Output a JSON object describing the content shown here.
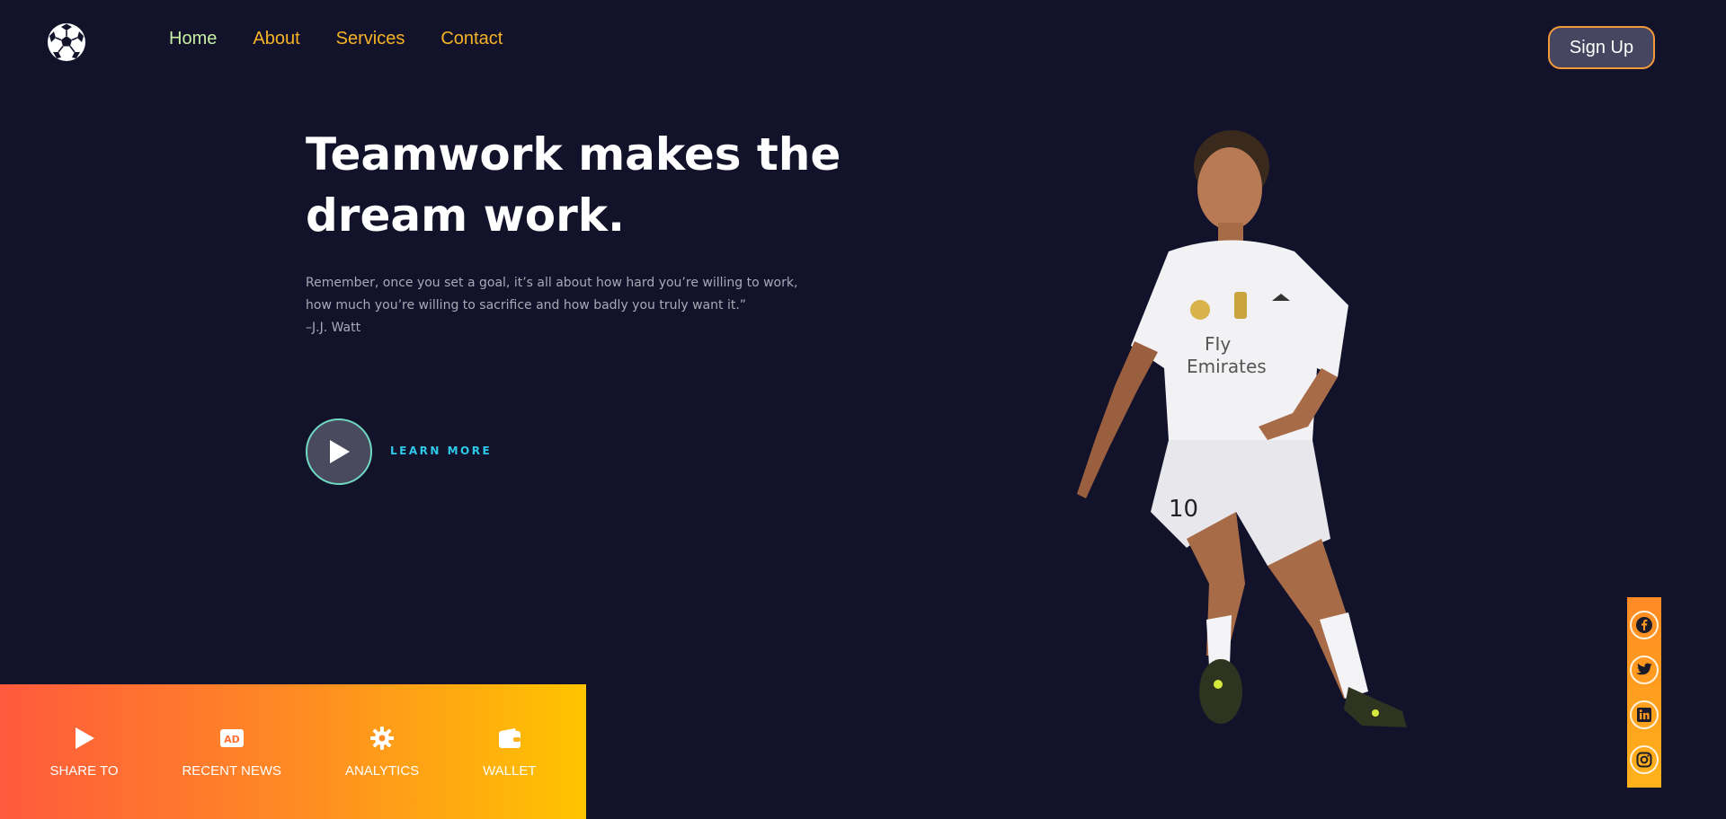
{
  "nav": {
    "items": [
      {
        "label": "Home",
        "active": true
      },
      {
        "label": "About",
        "active": false
      },
      {
        "label": "Services",
        "active": false
      },
      {
        "label": "Contact",
        "active": false
      }
    ],
    "signup_label": "Sign Up"
  },
  "hero": {
    "title": "Teamwork makes the dream work.",
    "quote_line1": "Remember, once you set a goal, it’s all about how hard you’re willing to work,",
    "quote_line2": "how much you’re willing to sacrifice and how badly you truly want it.”",
    "quote_author": "–J.J. Watt",
    "learn_more": "LEARN MORE"
  },
  "bottom_bar": {
    "items": [
      {
        "label": "SHARE TO",
        "icon": "play-icon"
      },
      {
        "label": "RECENT NEWS",
        "icon": "ad-icon",
        "badge": "AD"
      },
      {
        "label": "ANALYTICS",
        "icon": "gear-icon"
      },
      {
        "label": "WALLET",
        "icon": "wallet-icon"
      }
    ]
  },
  "social": [
    "facebook-icon",
    "twitter-icon",
    "linkedin-icon",
    "instagram-icon"
  ],
  "colors": {
    "background": "#13122b",
    "nav_link": "#f5b325",
    "nav_active": "#c8f0a4",
    "accent_cyan": "#2fc8e8",
    "gradient_start": "#ff5a3c",
    "gradient_end": "#ffc400"
  }
}
